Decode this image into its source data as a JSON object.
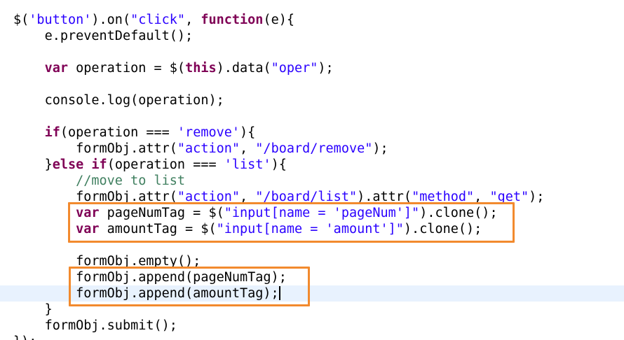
{
  "editor": {
    "lines": [
      {
        "indent": "",
        "tokens": [
          {
            "t": "plain",
            "v": "$("
          },
          {
            "t": "str",
            "v": "'button'"
          },
          {
            "t": "plain",
            "v": ").on("
          },
          {
            "t": "str",
            "v": "\"click\""
          },
          {
            "t": "plain",
            "v": ", "
          },
          {
            "t": "kw",
            "v": "function"
          },
          {
            "t": "plain",
            "v": "(e){"
          }
        ]
      },
      {
        "indent": "    ",
        "tokens": [
          {
            "t": "plain",
            "v": "e.preventDefault();"
          }
        ]
      },
      {
        "indent": "",
        "tokens": []
      },
      {
        "indent": "    ",
        "tokens": [
          {
            "t": "kw",
            "v": "var"
          },
          {
            "t": "plain",
            "v": " operation = $("
          },
          {
            "t": "kw",
            "v": "this"
          },
          {
            "t": "plain",
            "v": ").data("
          },
          {
            "t": "str",
            "v": "\"oper\""
          },
          {
            "t": "plain",
            "v": ");"
          }
        ]
      },
      {
        "indent": "",
        "tokens": []
      },
      {
        "indent": "    ",
        "tokens": [
          {
            "t": "plain",
            "v": "console.log(operation);"
          }
        ]
      },
      {
        "indent": "",
        "tokens": []
      },
      {
        "indent": "    ",
        "tokens": [
          {
            "t": "kw",
            "v": "if"
          },
          {
            "t": "plain",
            "v": "(operation === "
          },
          {
            "t": "str",
            "v": "'remove'"
          },
          {
            "t": "plain",
            "v": "){"
          }
        ]
      },
      {
        "indent": "        ",
        "tokens": [
          {
            "t": "plain",
            "v": "formObj.attr("
          },
          {
            "t": "str",
            "v": "\"action\""
          },
          {
            "t": "plain",
            "v": ", "
          },
          {
            "t": "str",
            "v": "\"/board/remove\""
          },
          {
            "t": "plain",
            "v": ");"
          }
        ]
      },
      {
        "indent": "    ",
        "tokens": [
          {
            "t": "plain",
            "v": "}"
          },
          {
            "t": "kw",
            "v": "else"
          },
          {
            "t": "plain",
            "v": " "
          },
          {
            "t": "kw",
            "v": "if"
          },
          {
            "t": "plain",
            "v": "(operation === "
          },
          {
            "t": "str",
            "v": "'list'"
          },
          {
            "t": "plain",
            "v": "){"
          }
        ]
      },
      {
        "indent": "        ",
        "tokens": [
          {
            "t": "cmt",
            "v": "//move to list"
          }
        ]
      },
      {
        "indent": "        ",
        "tokens": [
          {
            "t": "plain",
            "v": "formObj.attr("
          },
          {
            "t": "str",
            "v": "\"action\""
          },
          {
            "t": "plain",
            "v": ", "
          },
          {
            "t": "str",
            "v": "\"/board/list\""
          },
          {
            "t": "plain",
            "v": ").attr("
          },
          {
            "t": "str",
            "v": "\"method\""
          },
          {
            "t": "plain",
            "v": ", "
          },
          {
            "t": "str",
            "v": "\"get\""
          },
          {
            "t": "plain",
            "v": ");"
          }
        ]
      },
      {
        "indent": "        ",
        "tokens": [
          {
            "t": "kw",
            "v": "var"
          },
          {
            "t": "plain",
            "v": " pageNumTag = $("
          },
          {
            "t": "str",
            "v": "\"input[name = 'pageNum']\""
          },
          {
            "t": "plain",
            "v": ").clone();"
          }
        ]
      },
      {
        "indent": "        ",
        "tokens": [
          {
            "t": "kw",
            "v": "var"
          },
          {
            "t": "plain",
            "v": " amountTag = $("
          },
          {
            "t": "str",
            "v": "\"input[name = 'amount']\""
          },
          {
            "t": "plain",
            "v": ").clone();"
          }
        ]
      },
      {
        "indent": "",
        "tokens": []
      },
      {
        "indent": "        ",
        "tokens": [
          {
            "t": "plain",
            "v": "formObj.empty();"
          }
        ]
      },
      {
        "indent": "        ",
        "tokens": [
          {
            "t": "plain",
            "v": "formObj.append(pageNumTag);"
          }
        ]
      },
      {
        "indent": "        ",
        "tokens": [
          {
            "t": "plain",
            "v": "formObj.append(amountTag);"
          }
        ],
        "current": true,
        "caret": true
      },
      {
        "indent": "    ",
        "tokens": [
          {
            "t": "plain",
            "v": "}"
          }
        ]
      },
      {
        "indent": "    ",
        "tokens": [
          {
            "t": "plain",
            "v": "formObj.submit();"
          }
        ]
      },
      {
        "indent": "",
        "tokens": [
          {
            "t": "plain",
            "v": "});"
          }
        ]
      }
    ],
    "colors": {
      "keyword": "#7f0055",
      "string": "#2a00ff",
      "comment": "#3f7f5f",
      "current_line": "#e8f2fe",
      "highlight_box": "#f28a2e"
    }
  }
}
